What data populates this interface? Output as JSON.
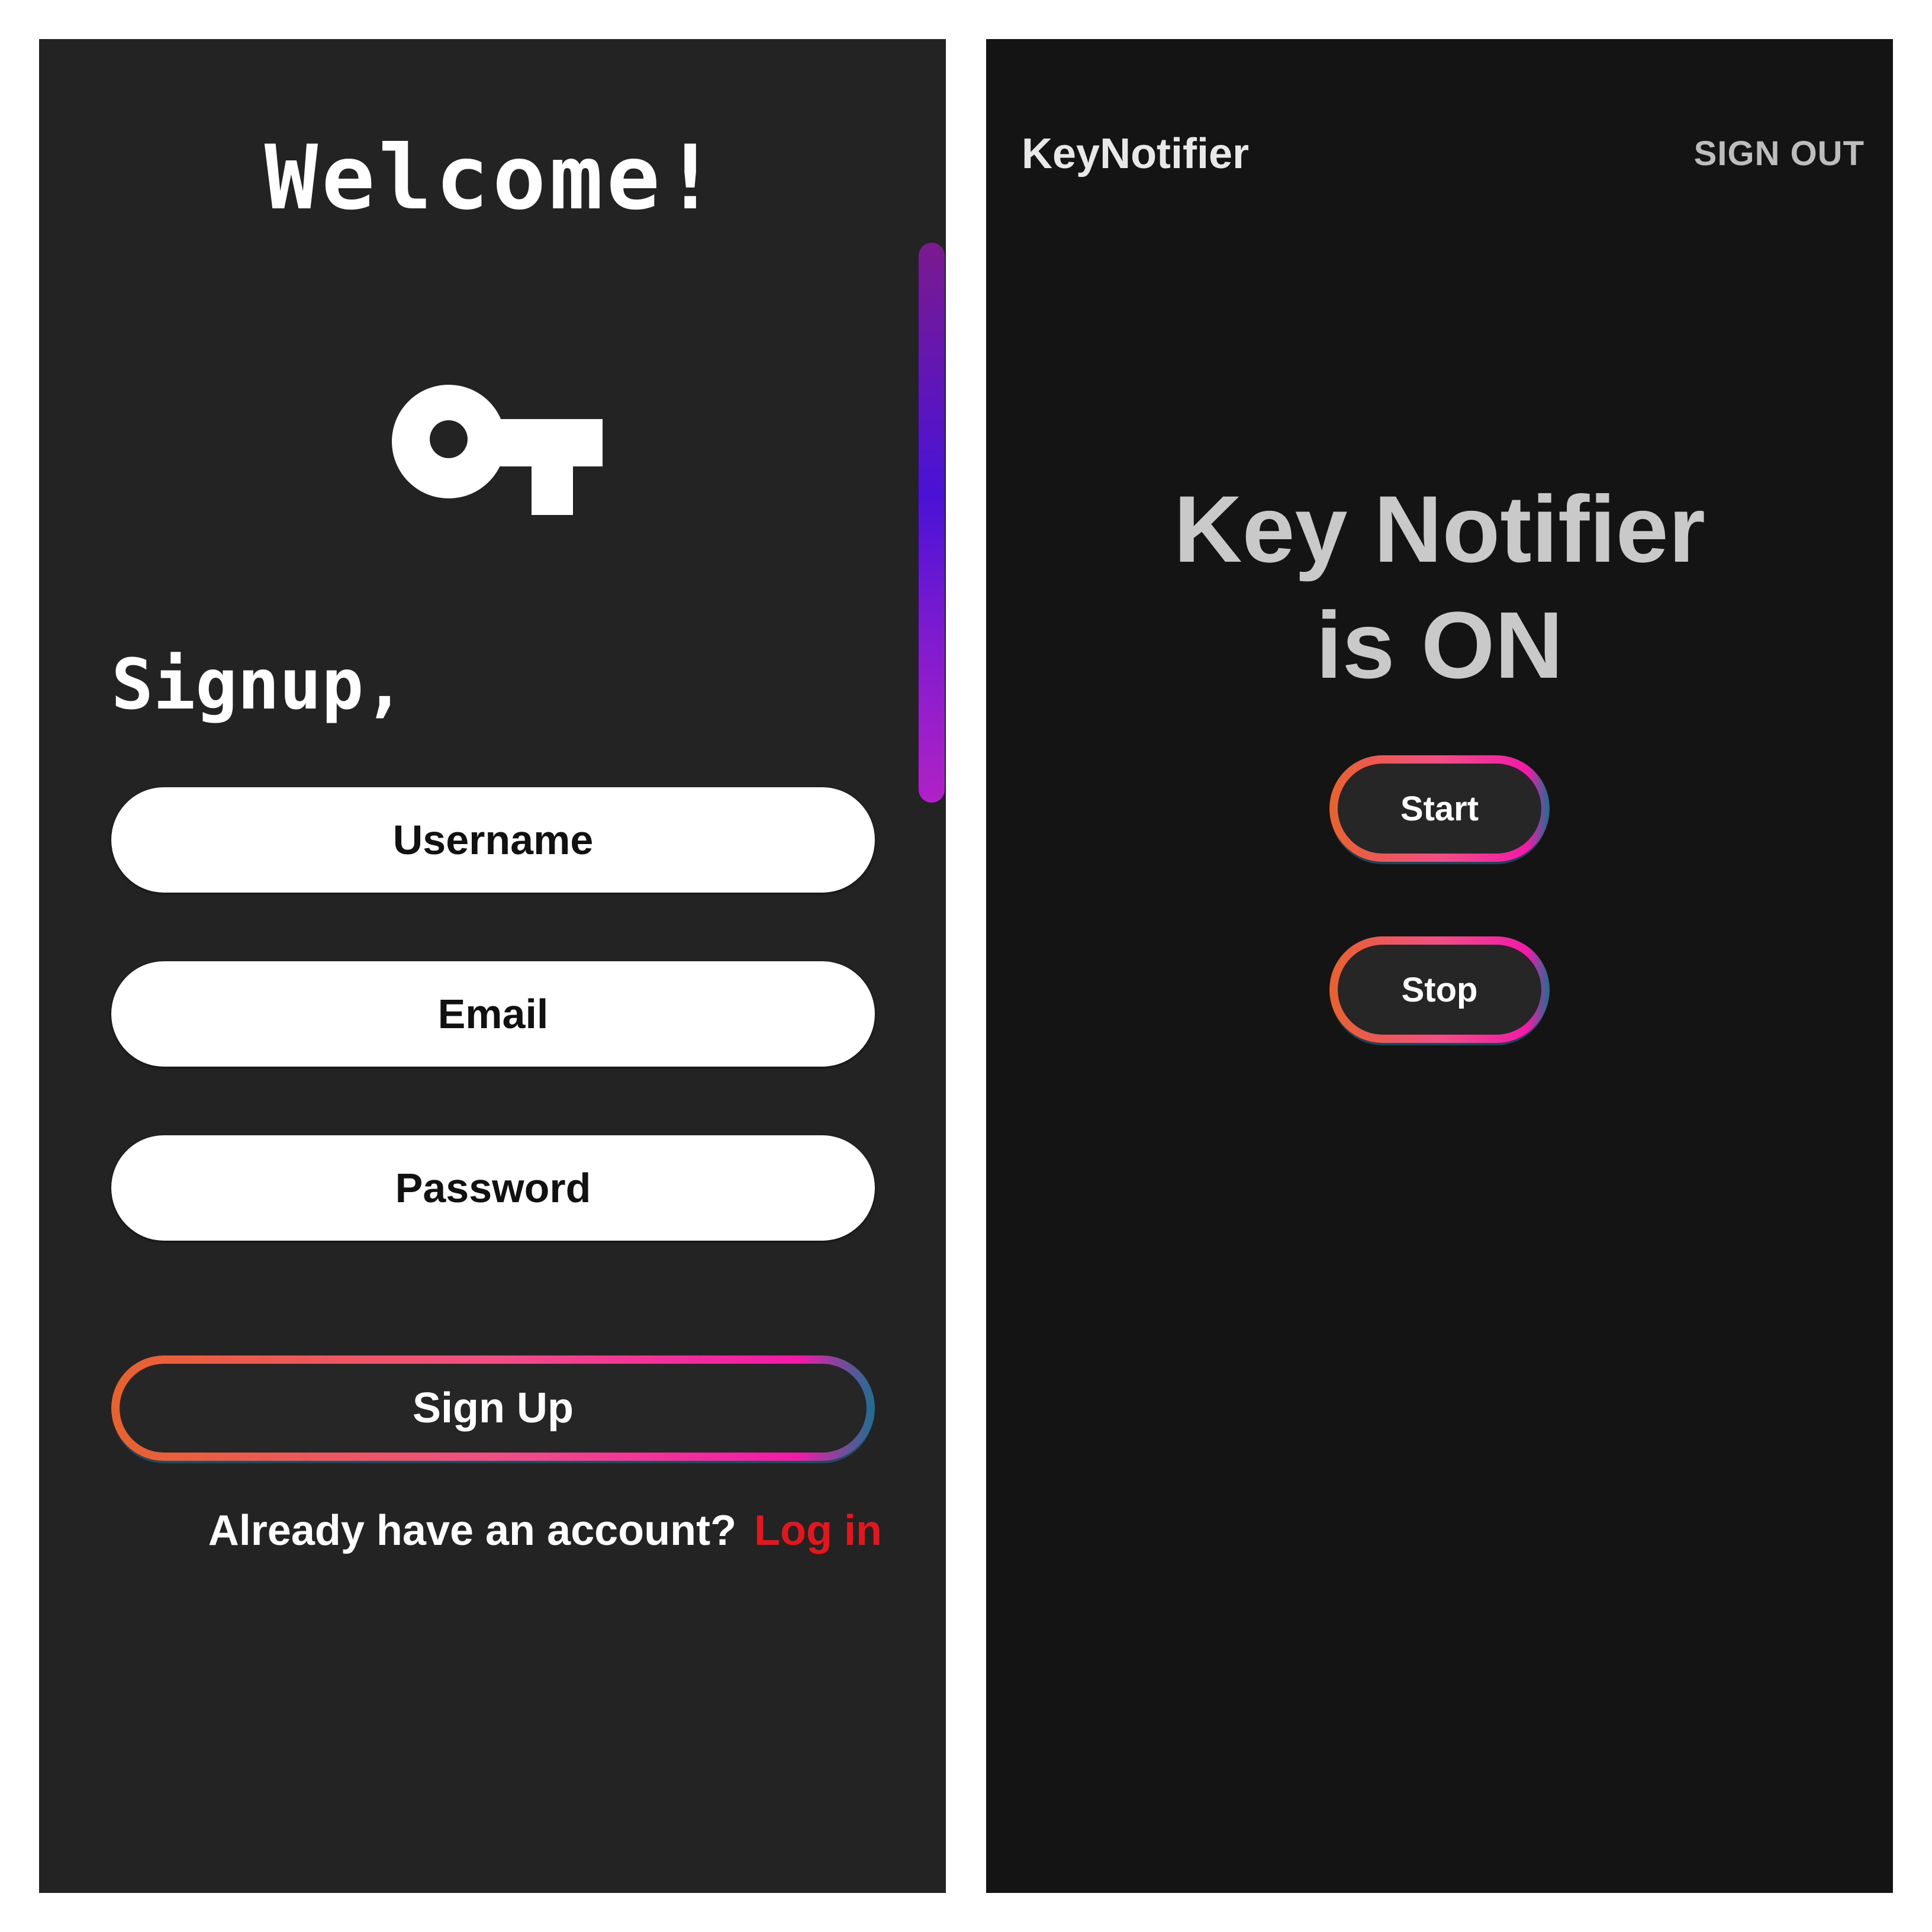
{
  "signup_screen": {
    "welcome_title": "Welcome!",
    "heading": "Signup,",
    "fields": {
      "username_placeholder": "Username",
      "email_placeholder": "Email",
      "password_placeholder": "Password"
    },
    "signup_button_label": "Sign Up",
    "login_prompt": "Already have an account?",
    "login_link_label": "Log in",
    "icons": {
      "logo": "key-icon"
    },
    "colors": {
      "background": "#232323",
      "field_background": "#ffffff",
      "login_link": "#e3161d",
      "scrollbar": "#7e1bcf"
    }
  },
  "home_screen": {
    "app_title": "KeyNotifier",
    "signout_label": "SIGN OUT",
    "status_line1": "Key Notifier",
    "status_line2": "is ON",
    "start_button_label": "Start",
    "stop_button_label": "Stop",
    "colors": {
      "background": "#141414",
      "button_gradient": [
        "#e8622e",
        "#f04f84",
        "#f21aa9",
        "#1d6f91"
      ]
    }
  }
}
